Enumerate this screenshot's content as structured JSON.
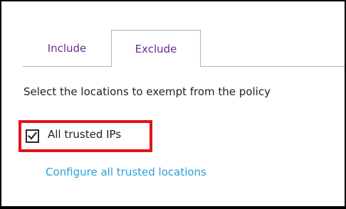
{
  "tabs": [
    {
      "label": "Include",
      "active": false
    },
    {
      "label": "Exclude",
      "active": true
    }
  ],
  "instructions": "Select the locations to exempt from the policy",
  "trusted_ips": {
    "label": "All trusted IPs",
    "checked": true
  },
  "configure_link": "Configure all trusted locations",
  "colors": {
    "tab_text": "#6d2b8f",
    "link": "#2a9fd6",
    "highlight_border": "#e3121d",
    "body_text": "#222222",
    "tab_border": "#b3b3b3"
  },
  "icons": {
    "checkbox_mark": "check-icon"
  }
}
